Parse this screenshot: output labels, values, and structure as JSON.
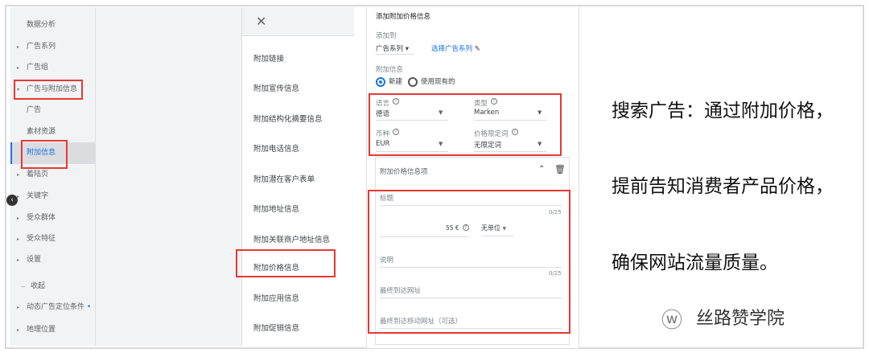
{
  "sidebar": {
    "items": [
      {
        "label": "数据分析",
        "arrow": ""
      },
      {
        "label": "广告系列",
        "arrow": "▸"
      },
      {
        "label": "广告组",
        "arrow": "▸"
      },
      {
        "label": "广告与附加信息",
        "arrow": "▾"
      },
      {
        "label": "广告",
        "arrow": ""
      },
      {
        "label": "素材资源",
        "arrow": ""
      },
      {
        "label": "附加信息",
        "arrow": ""
      },
      {
        "label": "着陆页",
        "arrow": "▸"
      },
      {
        "label": "关键字",
        "arrow": "▸"
      },
      {
        "label": "受众群体",
        "arrow": "▸"
      },
      {
        "label": "受众特征",
        "arrow": "▸"
      },
      {
        "label": "设置",
        "arrow": "▸"
      },
      {
        "label": "收起",
        "arrow": "—"
      },
      {
        "label": "动态广告定位条件",
        "arrow": "▸"
      },
      {
        "label": "地理位置",
        "arrow": "▸"
      }
    ]
  },
  "drawer": {
    "close": "✕",
    "items": [
      "附加链接",
      "附加宣传信息",
      "附加结构化摘要信息",
      "附加电话信息",
      "附加潜在客户表单",
      "附加地址信息",
      "附加关联商户地址信息",
      "附加价格信息",
      "附加应用信息",
      "附加促销信息"
    ]
  },
  "form": {
    "title": "添加附加价格信息",
    "add_to_label": "添加到",
    "add_to_value": "广告系列",
    "select_link": "选择广告系列",
    "ext_label": "附加信息",
    "radio_new": "新建",
    "radio_existing": "使用现有的",
    "language_label": "语言",
    "language_value": "德语",
    "type_label": "类型",
    "type_value": "Marken",
    "currency_label": "币种",
    "currency_value": "EUR",
    "qualifier_label": "价格限定词",
    "qualifier_value": "无限定词",
    "item_title": "附加价格信息项",
    "header_label": "标题",
    "header_count": "0/25",
    "price": "55 €",
    "unit": "无单位",
    "desc_label": "说明",
    "desc_count": "0/25",
    "final_url": "最终到达网址",
    "mobile_url": "最终到达移动网址（可选）"
  },
  "slogan": [
    "搜索广告：通过附加价格，",
    "提前告知消费者产品价格，",
    "确保网站流量质量。"
  ],
  "brand": "丝路赞学院"
}
